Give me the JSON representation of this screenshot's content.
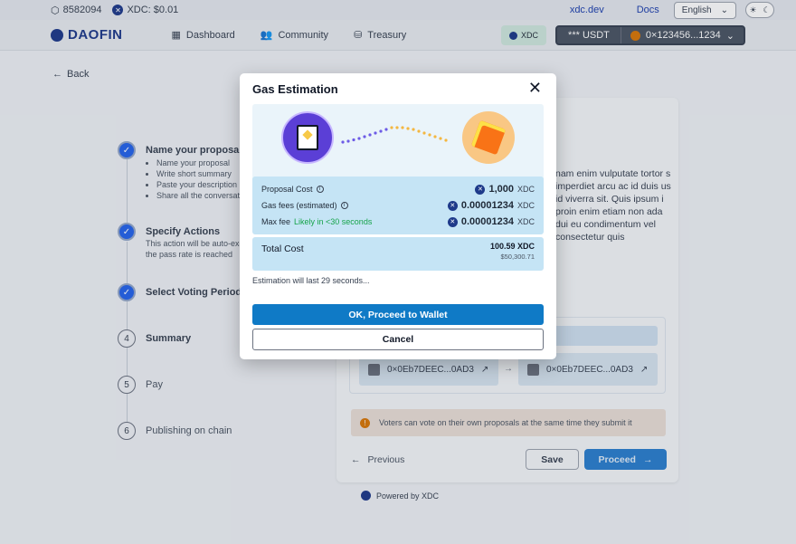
{
  "topbar": {
    "block_number": "8582094",
    "xdc_price": "XDC: $0.01",
    "site_link": "xdc.dev",
    "docs_link": "Docs",
    "language": "English"
  },
  "nav": {
    "brand": "DAOFIN",
    "items": [
      {
        "label": "Dashboard"
      },
      {
        "label": "Community"
      },
      {
        "label": "Treasury"
      }
    ],
    "network": "XDC",
    "balance": "*** USDT",
    "address": "0×123456...1234"
  },
  "back_label": "Back",
  "steps": [
    {
      "number": "1",
      "title": "Name your proposal",
      "items": [
        "Name your proposal",
        "Write short summary",
        "Paste your description",
        "Share all the conversati"
      ]
    },
    {
      "number": "2",
      "title": "Specify Actions",
      "desc": [
        "This action will be auto-exe",
        "the pass rate is reached"
      ]
    },
    {
      "number": "3",
      "title": "Select Voting Period"
    },
    {
      "number": "4",
      "title": "Summary"
    },
    {
      "number": "5",
      "title": "Pay"
    },
    {
      "number": "6",
      "title": "Publishing on chain"
    }
  ],
  "card": {
    "lorem": "nam enim vulputate tortor s imperdiet arcu ac id duis us id viverra sit. Quis ipsum i proin enim etiam non ada dui eu condimentum vel consectetur quis",
    "from_address": "0×0Eb7DEEC...0AD3",
    "to_address": "0×0Eb7DEEC...0AD3",
    "notice": "Voters can vote on their own proposals at the same time they submit it",
    "previous": "Previous",
    "save": "Save",
    "proceed": "Proceed"
  },
  "powered_by": "Powered by XDC",
  "modal": {
    "title": "Gas Estimation",
    "proposal_cost_label": "Proposal Cost",
    "proposal_cost_value": "1,000",
    "gas_fees_label": "Gas fees (estimated)",
    "gas_fees_value": "0.00001234",
    "max_fee_label": "Max fee",
    "max_fee_hint": "Likely in <30 seconds",
    "max_fee_value": "0.00001234",
    "unit": "XDC",
    "total_label": "Total Cost",
    "total_value": "100.59 XDC",
    "total_usd": "$50,300.71",
    "estimation_note": "Estimation will last 29 seconds...",
    "ok_button": "OK, Proceed to Wallet",
    "cancel_button": "Cancel"
  },
  "colors": {
    "primary": "#0f7ac6",
    "brand": "#1e3a8a",
    "success": "#16a34a"
  }
}
